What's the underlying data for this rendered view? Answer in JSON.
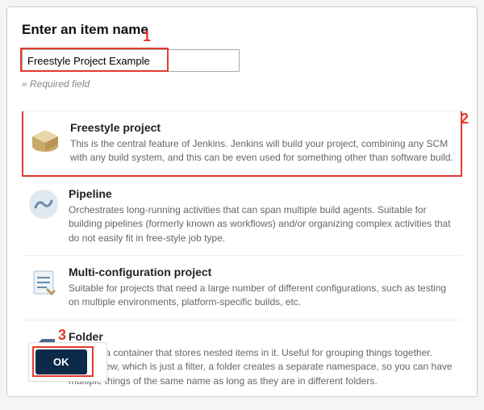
{
  "heading": "Enter an item name",
  "input": {
    "value": "Freestyle Project Example",
    "placeholder": ""
  },
  "required_text": "» Required field",
  "annotations": {
    "input": "1",
    "option": "2",
    "ok": "3"
  },
  "options": [
    {
      "title": "Freestyle project",
      "desc": "This is the central feature of Jenkins. Jenkins will build your project, combining any SCM with any build system, and this can be even used for something other than software build.",
      "highlight": true
    },
    {
      "title": "Pipeline",
      "desc": "Orchestrates long-running activities that can span multiple build agents. Suitable for building pipelines (formerly known as workflows) and/or organizing complex activities that do not easily fit in free-style job type."
    },
    {
      "title": "Multi-configuration project",
      "desc": "Suitable for projects that need a large number of different configurations, such as testing on multiple environments, platform-specific builds, etc."
    },
    {
      "title": "Folder",
      "desc": "Creates a container that stores nested items in it. Useful for grouping things together. Unlike view, which is just a filter, a folder creates a separate namespace, so you can have multiple things of the same name as long as they are in different folders."
    }
  ],
  "ok_label": "OK"
}
